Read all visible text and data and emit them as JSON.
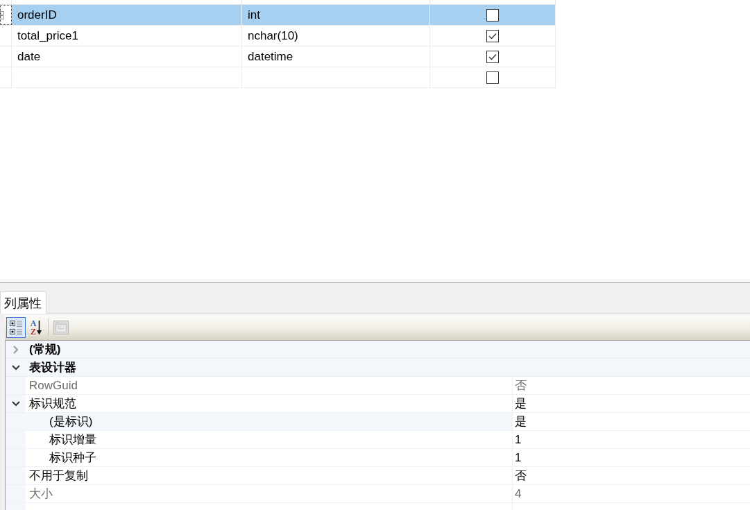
{
  "grid": {
    "rows": [
      {
        "selected": true,
        "column_1": "orderID",
        "column_2": "int",
        "checked": false
      },
      {
        "selected": false,
        "column_1": "total_price1",
        "column_2": "nchar(10)",
        "checked": true
      },
      {
        "selected": false,
        "column_1": "date",
        "column_2": "datetime",
        "checked": true
      },
      {
        "selected": false,
        "checked": false
      }
    ]
  },
  "properties_panel": {
    "tabs": [
      {
        "label": "列属性",
        "selected": true
      }
    ],
    "toolbar": [
      {
        "kind": "categorized",
        "selected": true,
        "disabled": false
      },
      {
        "kind": "alphabetical",
        "selected": false,
        "disabled": false,
        "glyphs": [
          "A",
          "Z"
        ]
      },
      {
        "kind": "property_pages",
        "selected": false,
        "disabled": true
      }
    ],
    "categories": [
      {
        "name": "(常规)",
        "expanded": false
      },
      {
        "name": "表设计器",
        "expanded": true,
        "properties": [
          {
            "name": "RowGuid",
            "value": "否",
            "read_only": true,
            "selected": false
          },
          {
            "name": "标识规范",
            "value": "是",
            "read_only": false,
            "selected": false,
            "expanded": true,
            "children": [
              {
                "name": "(是标识)",
                "value": "是",
                "read_only": false,
                "selected": true
              },
              {
                "name": "标识增量",
                "value": "1",
                "read_only": false,
                "selected": false
              },
              {
                "name": "标识种子",
                "value": "1",
                "read_only": false,
                "selected": false
              }
            ]
          },
          {
            "name": "不用于复制",
            "value": "否",
            "read_only": false,
            "selected": false
          },
          {
            "name": "大小",
            "value": "4",
            "read_only": true,
            "selected": false
          }
        ]
      }
    ]
  }
}
